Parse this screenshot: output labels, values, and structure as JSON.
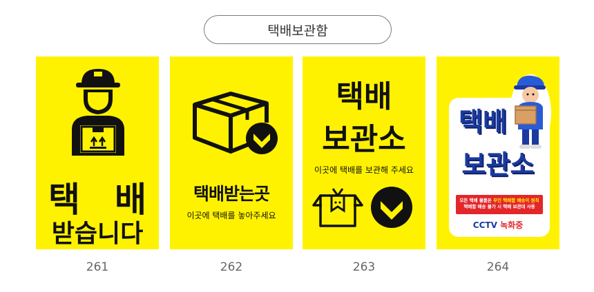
{
  "header": {
    "title": "택배보관함"
  },
  "cards": [
    {
      "number": "261",
      "line1_a": "택",
      "line1_b": "배",
      "line2": "받습니다"
    },
    {
      "number": "262",
      "title": "택배받는곳",
      "subtitle": "이곳에 택배를 놓아주세요"
    },
    {
      "number": "263",
      "line1": "택배",
      "line2": "보관소",
      "subtitle": "이곳에 택배를 보관해 주세요"
    },
    {
      "number": "264",
      "line1": "택배",
      "line2": "보관소",
      "notice_line1_a": "모든 택배 물품은",
      "notice_line1_hl": "무인 택배함 배송이 원칙",
      "notice_line2": "택배함 배송 불가 시 택배 보관대 사용",
      "footer_a": "CCTV",
      "footer_b": "녹화중"
    }
  ],
  "colors": {
    "sign_yellow": "#FFF200",
    "ink": "#111111",
    "blue": "#1a3aa0",
    "red": "#e3262a"
  }
}
